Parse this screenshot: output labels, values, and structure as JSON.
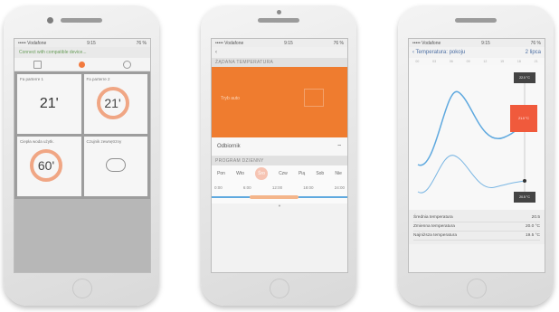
{
  "phone1": {
    "status": {
      "carrier": "••••• Vodafone",
      "time": "9:15",
      "battery": "76 %"
    },
    "topbar": "Connect with compatible device...",
    "tiles": [
      {
        "label": "Fa parterre 1",
        "value": "21'"
      },
      {
        "label": "Fa parterre 2",
        "value": "21'"
      },
      {
        "label": "Ciepła woda użytk.",
        "value": "60'"
      },
      {
        "label": "Czujnik zewnętrzny",
        "value": ""
      }
    ]
  },
  "phone2": {
    "status": {
      "carrier": "••••• Vodafone",
      "time": "9:15",
      "battery": "76 %"
    },
    "back": "‹",
    "section1": "ŻĄDANA TEMPERATURA",
    "orange_text": "Tryb auto",
    "row_label": "Odbiornik",
    "section2": "PROGRAM DZIENNY",
    "days": [
      "Pon",
      "Wto",
      "Śro",
      "Czw",
      "Pią",
      "Sob",
      "Nie"
    ],
    "times": [
      "0:00",
      "6:00",
      "12:00",
      "18:00",
      "24:00"
    ]
  },
  "phone3": {
    "status": {
      "carrier": "••••• Vodafone",
      "time": "9:15",
      "battery": "76 %"
    },
    "title": "‹ Temperatura: pokoju",
    "right": "2 lipca",
    "hours": [
      "00",
      "03",
      "06",
      "09",
      "12",
      "15",
      "18",
      "21"
    ],
    "badges": [
      "22.0 °C",
      "21.0 °C",
      "20.5 °C"
    ],
    "table": [
      {
        "label": "Średnia temperatura",
        "value": "20.5"
      },
      {
        "label": "Zmienna temperatura",
        "value": "20.0 °C"
      },
      {
        "label": "Najniższa temperatura",
        "value": "19.5 °C"
      }
    ],
    "colors": {
      "orange": "#ef7c2f",
      "red": "#f05a3c",
      "blue": "#5fa9df"
    }
  }
}
